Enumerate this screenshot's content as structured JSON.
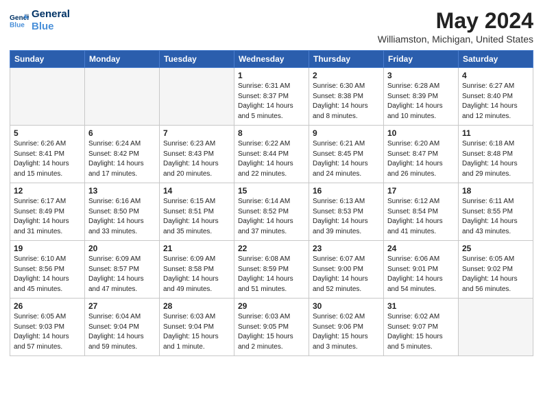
{
  "header": {
    "logo_line1": "General",
    "logo_line2": "Blue",
    "month_title": "May 2024",
    "location": "Williamston, Michigan, United States"
  },
  "weekdays": [
    "Sunday",
    "Monday",
    "Tuesday",
    "Wednesday",
    "Thursday",
    "Friday",
    "Saturday"
  ],
  "weeks": [
    [
      {
        "day": "",
        "text": ""
      },
      {
        "day": "",
        "text": ""
      },
      {
        "day": "",
        "text": ""
      },
      {
        "day": "1",
        "text": "Sunrise: 6:31 AM\nSunset: 8:37 PM\nDaylight: 14 hours\nand 5 minutes."
      },
      {
        "day": "2",
        "text": "Sunrise: 6:30 AM\nSunset: 8:38 PM\nDaylight: 14 hours\nand 8 minutes."
      },
      {
        "day": "3",
        "text": "Sunrise: 6:28 AM\nSunset: 8:39 PM\nDaylight: 14 hours\nand 10 minutes."
      },
      {
        "day": "4",
        "text": "Sunrise: 6:27 AM\nSunset: 8:40 PM\nDaylight: 14 hours\nand 12 minutes."
      }
    ],
    [
      {
        "day": "5",
        "text": "Sunrise: 6:26 AM\nSunset: 8:41 PM\nDaylight: 14 hours\nand 15 minutes."
      },
      {
        "day": "6",
        "text": "Sunrise: 6:24 AM\nSunset: 8:42 PM\nDaylight: 14 hours\nand 17 minutes."
      },
      {
        "day": "7",
        "text": "Sunrise: 6:23 AM\nSunset: 8:43 PM\nDaylight: 14 hours\nand 20 minutes."
      },
      {
        "day": "8",
        "text": "Sunrise: 6:22 AM\nSunset: 8:44 PM\nDaylight: 14 hours\nand 22 minutes."
      },
      {
        "day": "9",
        "text": "Sunrise: 6:21 AM\nSunset: 8:45 PM\nDaylight: 14 hours\nand 24 minutes."
      },
      {
        "day": "10",
        "text": "Sunrise: 6:20 AM\nSunset: 8:47 PM\nDaylight: 14 hours\nand 26 minutes."
      },
      {
        "day": "11",
        "text": "Sunrise: 6:18 AM\nSunset: 8:48 PM\nDaylight: 14 hours\nand 29 minutes."
      }
    ],
    [
      {
        "day": "12",
        "text": "Sunrise: 6:17 AM\nSunset: 8:49 PM\nDaylight: 14 hours\nand 31 minutes."
      },
      {
        "day": "13",
        "text": "Sunrise: 6:16 AM\nSunset: 8:50 PM\nDaylight: 14 hours\nand 33 minutes."
      },
      {
        "day": "14",
        "text": "Sunrise: 6:15 AM\nSunset: 8:51 PM\nDaylight: 14 hours\nand 35 minutes."
      },
      {
        "day": "15",
        "text": "Sunrise: 6:14 AM\nSunset: 8:52 PM\nDaylight: 14 hours\nand 37 minutes."
      },
      {
        "day": "16",
        "text": "Sunrise: 6:13 AM\nSunset: 8:53 PM\nDaylight: 14 hours\nand 39 minutes."
      },
      {
        "day": "17",
        "text": "Sunrise: 6:12 AM\nSunset: 8:54 PM\nDaylight: 14 hours\nand 41 minutes."
      },
      {
        "day": "18",
        "text": "Sunrise: 6:11 AM\nSunset: 8:55 PM\nDaylight: 14 hours\nand 43 minutes."
      }
    ],
    [
      {
        "day": "19",
        "text": "Sunrise: 6:10 AM\nSunset: 8:56 PM\nDaylight: 14 hours\nand 45 minutes."
      },
      {
        "day": "20",
        "text": "Sunrise: 6:09 AM\nSunset: 8:57 PM\nDaylight: 14 hours\nand 47 minutes."
      },
      {
        "day": "21",
        "text": "Sunrise: 6:09 AM\nSunset: 8:58 PM\nDaylight: 14 hours\nand 49 minutes."
      },
      {
        "day": "22",
        "text": "Sunrise: 6:08 AM\nSunset: 8:59 PM\nDaylight: 14 hours\nand 51 minutes."
      },
      {
        "day": "23",
        "text": "Sunrise: 6:07 AM\nSunset: 9:00 PM\nDaylight: 14 hours\nand 52 minutes."
      },
      {
        "day": "24",
        "text": "Sunrise: 6:06 AM\nSunset: 9:01 PM\nDaylight: 14 hours\nand 54 minutes."
      },
      {
        "day": "25",
        "text": "Sunrise: 6:05 AM\nSunset: 9:02 PM\nDaylight: 14 hours\nand 56 minutes."
      }
    ],
    [
      {
        "day": "26",
        "text": "Sunrise: 6:05 AM\nSunset: 9:03 PM\nDaylight: 14 hours\nand 57 minutes."
      },
      {
        "day": "27",
        "text": "Sunrise: 6:04 AM\nSunset: 9:04 PM\nDaylight: 14 hours\nand 59 minutes."
      },
      {
        "day": "28",
        "text": "Sunrise: 6:03 AM\nSunset: 9:04 PM\nDaylight: 15 hours\nand 1 minute."
      },
      {
        "day": "29",
        "text": "Sunrise: 6:03 AM\nSunset: 9:05 PM\nDaylight: 15 hours\nand 2 minutes."
      },
      {
        "day": "30",
        "text": "Sunrise: 6:02 AM\nSunset: 9:06 PM\nDaylight: 15 hours\nand 3 minutes."
      },
      {
        "day": "31",
        "text": "Sunrise: 6:02 AM\nSunset: 9:07 PM\nDaylight: 15 hours\nand 5 minutes."
      },
      {
        "day": "",
        "text": ""
      }
    ]
  ]
}
